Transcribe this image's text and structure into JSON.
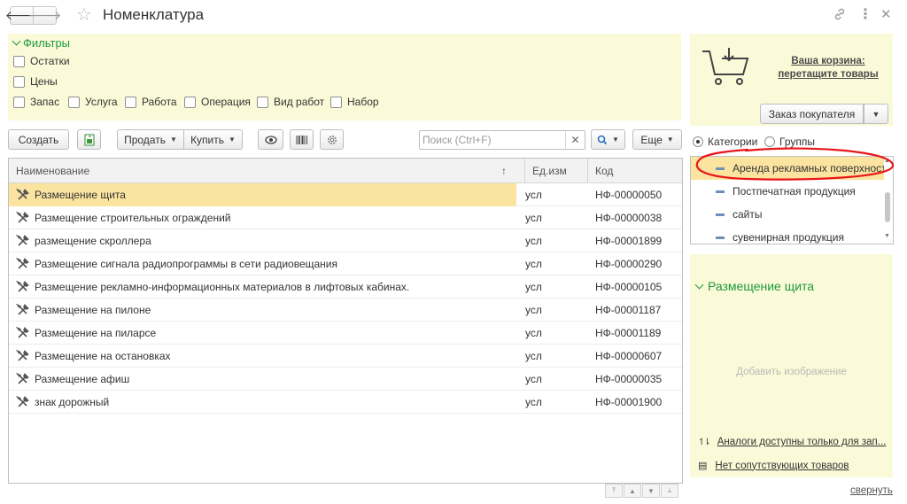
{
  "window": {
    "title": "Номенклатура"
  },
  "filters": {
    "header": "Фильтры",
    "checkboxes": [
      "Остатки",
      "Цены",
      "Запас",
      "Услуга",
      "Работа",
      "Операция",
      "Вид работ",
      "Набор"
    ]
  },
  "toolbar": {
    "create_label": "Создать",
    "sell_label": "Продать",
    "buy_label": "Купить",
    "search_placeholder": "Поиск (Ctrl+F)",
    "more_label": "Еще"
  },
  "table": {
    "columns": [
      "Наименование",
      "Ед.изм",
      "Код"
    ],
    "sort_indicator": "↑",
    "rows": [
      {
        "name": "Размещение щита",
        "unit": "усл",
        "code": "НФ-00000050"
      },
      {
        "name": "Размещение строительных ограждений",
        "unit": "усл",
        "code": "НФ-00000038"
      },
      {
        "name": "размещение скроллера",
        "unit": "усл",
        "code": "НФ-00001899"
      },
      {
        "name": "Размещение сигнала радиопрограммы в сети радиовещания",
        "unit": "усл",
        "code": "НФ-00000290"
      },
      {
        "name": "Размещение рекламно-информационных материалов в лифтовых кабинах.",
        "unit": "усл",
        "code": "НФ-00000105"
      },
      {
        "name": "Размещение на пилоне",
        "unit": "усл",
        "code": "НФ-00001187"
      },
      {
        "name": "Размещение на пиларсе",
        "unit": "усл",
        "code": "НФ-00001189"
      },
      {
        "name": "Размещение на остановках",
        "unit": "усл",
        "code": "НФ-00000607"
      },
      {
        "name": "Размещение афиш",
        "unit": "усл",
        "code": "НФ-00000035"
      },
      {
        "name": "знак дорожный",
        "unit": "усл",
        "code": "НФ-00001900"
      }
    ],
    "selected_index": 0
  },
  "cart": {
    "link_line1": "Ваша корзина:",
    "link_line2": "перетащите товары",
    "order_button": "Заказ покупателя"
  },
  "view_mode": {
    "options": [
      "Категории",
      "Группы"
    ],
    "selected": "Категории"
  },
  "categories": {
    "items": [
      "Аренда рекламных поверхност",
      "Постпечатная продукция",
      "сайты",
      "сувенирная продукция"
    ],
    "selected_index": 0
  },
  "details": {
    "header": "Размещение щита",
    "add_image": "Добавить изображение",
    "analogs_link": "Аналоги доступны только для зап...",
    "related_link": "Нет сопутствующих товаров"
  },
  "footer": {
    "collapse_label": "свернуть"
  },
  "colors": {
    "accent_green": "#1d9a3d",
    "panel_yellow": "#fafad8",
    "selection": "#fbe4a0",
    "annotation_red": "#e8161b"
  }
}
